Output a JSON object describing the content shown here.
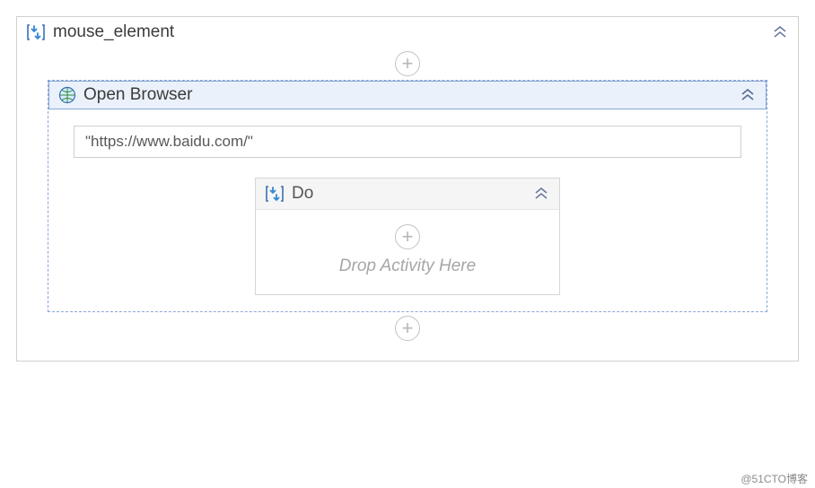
{
  "outer": {
    "title": "mouse_element"
  },
  "open_browser": {
    "title": "Open Browser",
    "url": "\"https://www.baidu.com/\""
  },
  "do": {
    "title": "Do",
    "drop_hint": "Drop Activity Here"
  },
  "watermark": "@51CTO博客"
}
